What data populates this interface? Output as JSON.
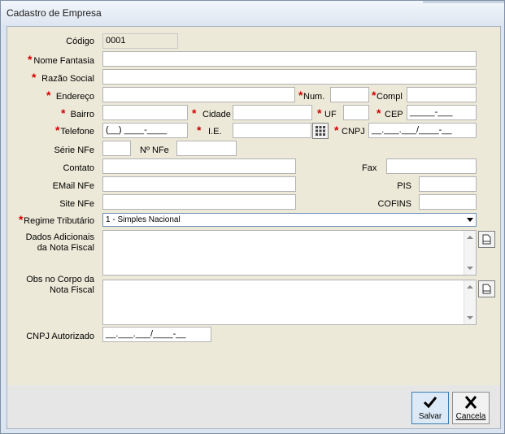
{
  "window": {
    "title": "Cadastro de Empresa"
  },
  "form": {
    "codigo": {
      "label": "Código",
      "value": "0001"
    },
    "nome_fantasia": {
      "label": "Nome Fantasia",
      "value": ""
    },
    "razao_social": {
      "label": "Razão Social",
      "value": ""
    },
    "endereco": {
      "label": "Endereço",
      "value": ""
    },
    "num": {
      "label": "Num.",
      "value": ""
    },
    "compl": {
      "label": "Compl",
      "value": ""
    },
    "bairro": {
      "label": "Bairro",
      "value": ""
    },
    "cidade": {
      "label": "Cidade",
      "value": ""
    },
    "uf": {
      "label": "UF",
      "value": ""
    },
    "cep": {
      "label": "CEP",
      "value": "_____-___"
    },
    "telefone": {
      "label": "Telefone",
      "value": "(__) ____-____"
    },
    "ie": {
      "label": "I.E.",
      "value": ""
    },
    "cnpj": {
      "label": "CNPJ",
      "value": "__.___.___/____-__"
    },
    "serie_nfe": {
      "label": "Série NFe",
      "value": ""
    },
    "n_nfe": {
      "label": "Nº NFe",
      "value": ""
    },
    "contato": {
      "label": "Contato",
      "value": ""
    },
    "fax": {
      "label": "Fax",
      "value": ""
    },
    "email_nfe": {
      "label": "EMail NFe",
      "value": ""
    },
    "pis": {
      "label": "PIS",
      "value": ""
    },
    "site_nfe": {
      "label": "Site NFe",
      "value": ""
    },
    "cofins": {
      "label": "COFINS",
      "value": ""
    },
    "regime": {
      "label": "Regime Tributário",
      "value": "1 - Simples Nacional"
    },
    "dados_adicionais": {
      "label_line1": "Dados Adicionais",
      "label_line2": "da Nota Fiscal",
      "value": ""
    },
    "obs_corpo": {
      "label_line1": "Obs no Corpo da",
      "label_line2": "Nota Fiscal",
      "value": ""
    },
    "cnpj_autorizado": {
      "label": "CNPJ Autorizado",
      "value": "__.___.___/____-__"
    },
    "required_mark": "*"
  },
  "footer": {
    "save_label": "Salvar",
    "cancel_label": "Cancela"
  },
  "colors": {
    "required": "#d40000",
    "accent": "#6f8fb8"
  }
}
